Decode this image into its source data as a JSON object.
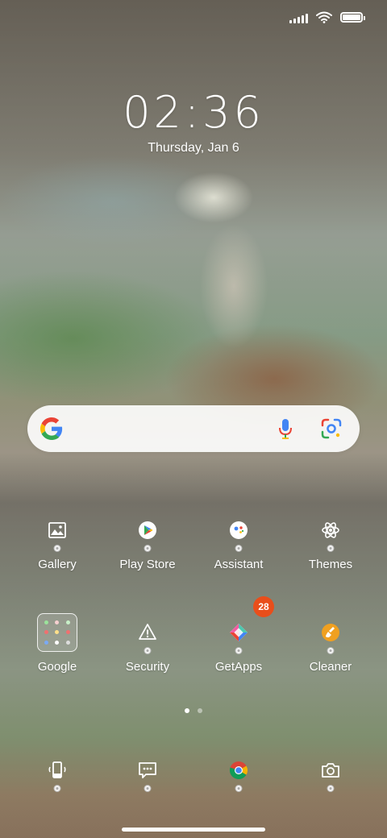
{
  "status_bar": {
    "icons": [
      "signal-icon",
      "wifi-icon",
      "battery-icon"
    ]
  },
  "clock_widget": {
    "time": "02:36",
    "date": "Thursday, Jan 6"
  },
  "search_bar": {
    "icons": [
      "google-logo-icon",
      "microphone-icon",
      "google-lens-icon"
    ]
  },
  "apps_row1": [
    {
      "label": "Gallery",
      "icon": "gallery-icon"
    },
    {
      "label": "Play Store",
      "icon": "play-store-icon"
    },
    {
      "label": "Assistant",
      "icon": "assistant-icon"
    },
    {
      "label": "Themes",
      "icon": "themes-icon"
    }
  ],
  "apps_row2": [
    {
      "label": "Google",
      "icon": "folder-icon"
    },
    {
      "label": "Security",
      "icon": "security-icon"
    },
    {
      "label": "GetApps",
      "icon": "getapps-icon",
      "badge": "28"
    },
    {
      "label": "Cleaner",
      "icon": "cleaner-icon"
    }
  ],
  "dock": [
    {
      "icon": "phone-icon"
    },
    {
      "icon": "messages-icon"
    },
    {
      "icon": "chrome-icon"
    },
    {
      "icon": "camera-icon"
    }
  ],
  "page_indicator": {
    "pages": 2,
    "active": 1
  },
  "colors": {
    "badge": "#e94e1b",
    "google_blue": "#4285F4",
    "google_red": "#EA4335",
    "google_yellow": "#FBBC05",
    "google_green": "#34A853"
  }
}
